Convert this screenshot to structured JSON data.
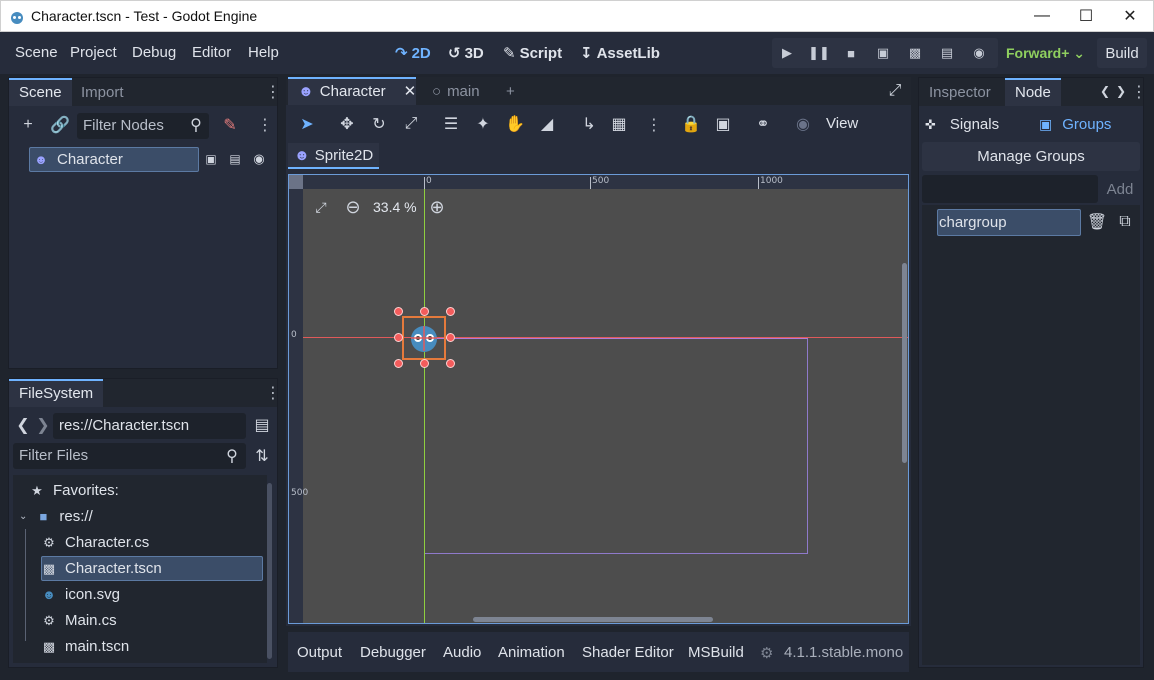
{
  "window": {
    "title": "Character.tscn - Test - Godot Engine",
    "minimize_icon": "minimize-icon",
    "maximize_icon": "maximize-icon",
    "close_icon": "close-icon"
  },
  "menu": {
    "items": [
      "Scene",
      "Project",
      "Debug",
      "Editor",
      "Help"
    ]
  },
  "workspaces": [
    {
      "label": "2D",
      "icon": "2d-icon",
      "active": true
    },
    {
      "label": "3D",
      "icon": "3d-icon",
      "active": false
    },
    {
      "label": "Script",
      "icon": "script-icon",
      "active": false
    },
    {
      "label": "AssetLib",
      "icon": "assetlib-icon",
      "active": false
    }
  ],
  "run_controls": [
    "play-icon",
    "pause-icon",
    "stop-icon",
    "remote-debug-icon",
    "play-scene-icon",
    "play-custom-icon",
    "movie-maker-icon"
  ],
  "renderer": "Forward+",
  "build_label": "Build",
  "scene_dock": {
    "tabs": [
      "Scene",
      "Import"
    ],
    "filter_placeholder": "Filter Nodes",
    "root_node": "Character"
  },
  "filesystem": {
    "tab": "FileSystem",
    "path": "res://Character.tscn",
    "filter_placeholder": "Filter Files",
    "items": [
      {
        "label": "Favorites:",
        "icon": "star-icon"
      },
      {
        "label": "res://",
        "icon": "folder-icon"
      },
      {
        "label": "Character.cs",
        "icon": "gear-icon"
      },
      {
        "label": "Character.tscn",
        "icon": "scene-icon"
      },
      {
        "label": "icon.svg",
        "icon": "image-icon"
      },
      {
        "label": "Main.cs",
        "icon": "gear-icon"
      },
      {
        "label": "main.tscn",
        "icon": "scene-icon"
      }
    ]
  },
  "editor": {
    "tabs": [
      "Character",
      "main"
    ],
    "view_label": "View",
    "breadcrumb": "Sprite2D",
    "zoom": "33.4 %",
    "ruler_h": [
      "0",
      "500",
      "1000"
    ],
    "ruler_v": [
      "0",
      "500"
    ]
  },
  "inspector": {
    "tabs": [
      "Inspector",
      "Node"
    ],
    "subtabs": [
      "Signals",
      "Groups"
    ],
    "manage_groups": "Manage Groups",
    "add_label": "Add",
    "group_name": "chargroup"
  },
  "bottom": {
    "tabs": [
      "Output",
      "Debugger",
      "Audio",
      "Animation",
      "Shader Editor",
      "MSBuild"
    ],
    "version": "4.1.1.stable.mono"
  },
  "colors": {
    "accent": "#6fb3ff",
    "renderer": "#8fcf5f",
    "handle": "#f45c5c"
  }
}
